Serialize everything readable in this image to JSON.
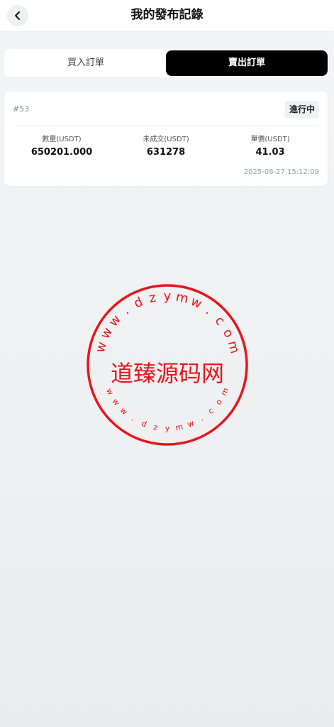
{
  "header": {
    "title": "我的發布記錄"
  },
  "tabs": [
    {
      "label": "買入訂單",
      "active": false
    },
    {
      "label": "賣出訂單",
      "active": true
    }
  ],
  "order": {
    "id": "#53",
    "status": "進行中",
    "quantity_label": "數量(USDT)",
    "quantity_value": "650201.000",
    "unfilled_label": "未成交(USDT)",
    "unfilled_value": "631278",
    "price_label": "單價(USDT)",
    "price_value": "41.03",
    "time": "2025-08-27 15:12:09"
  },
  "watermark": {
    "center_text": "道臻源码网",
    "ring_text": "www.dzymw.com",
    "color": "#e8151b"
  },
  "colors": {
    "accent": "#000000",
    "background": "#f2f3f5"
  }
}
